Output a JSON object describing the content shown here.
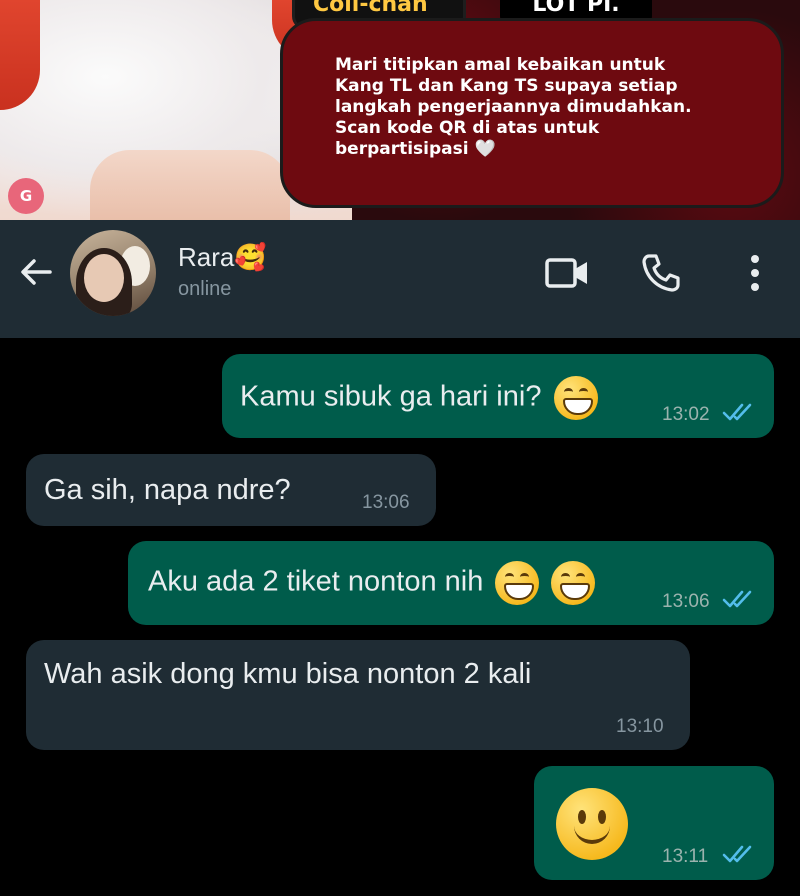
{
  "banner": {
    "character_name": "Coli-chan",
    "second_tab": "LOT PI.",
    "logo_text": "G",
    "promo_text": "Mari titipkan amal kebaikan untuk\nKang TL dan Kang TS supaya setiap\nlangkah pengerjaannya dimudahkan.\nScan kode QR di atas untuk\nberpartisipasi 🤍"
  },
  "header": {
    "contact_name": "Rara🥰",
    "status": "online"
  },
  "messages": [
    {
      "direction": "out",
      "text": "Kamu sibuk ga hari ini?",
      "emoji_count": 1,
      "time": "13:02",
      "read": true
    },
    {
      "direction": "in",
      "text": "Ga sih, napa ndre?",
      "time": "13:06"
    },
    {
      "direction": "out",
      "text": "Aku ada 2 tiket nonton nih",
      "emoji_count": 2,
      "time": "13:06",
      "read": true
    },
    {
      "direction": "in",
      "text": "Wah asik dong kmu bisa nonton 2 kali",
      "time": "13:10"
    },
    {
      "direction": "out",
      "text": "",
      "emoji": "slightly-smiling-face",
      "time": "13:11",
      "read": true
    }
  ],
  "colors": {
    "header_bg": "#1f2c34",
    "outgoing_bubble": "#005c4b",
    "incoming_bubble": "#1f2c34",
    "read_ticks": "#53bdeb",
    "promo_bubble": "#6e0a10"
  }
}
